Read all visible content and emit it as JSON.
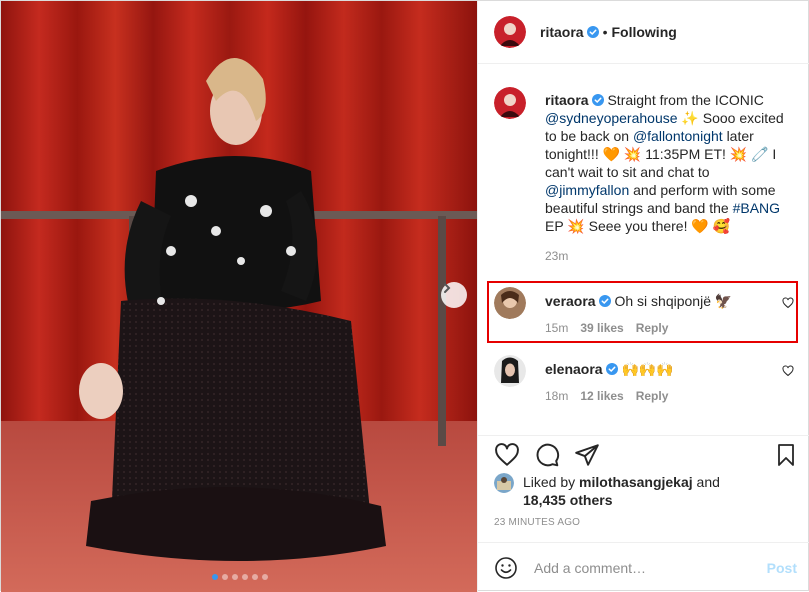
{
  "header": {
    "username": "ritaora",
    "separator": "•",
    "follow_state": "Following"
  },
  "caption": {
    "username": "ritaora",
    "t1": "Straight from the ICONIC",
    "mention1": "@sydneyoperahouse",
    "t2": "✨ Sooo excited to be back on",
    "mention2": "@fallontonight",
    "t3": "later tonight!!! 🧡 💥 11:35PM ET! 💥 🧷 I can't wait to sit and chat to",
    "mention3": "@jimmyfallon",
    "t4": "and perform with some beautiful strings and band the",
    "hashtag": "#BANG",
    "t5": "EP 💥 Seee you there! 🧡 🥰",
    "time": "23m"
  },
  "comments": [
    {
      "username": "veraora",
      "text": "Oh si shqiponjë 🦅",
      "time": "15m",
      "likes": "39 likes",
      "reply": "Reply"
    },
    {
      "username": "elenaora",
      "text": "🙌🙌🙌",
      "time": "18m",
      "likes": "12 likes",
      "reply": "Reply"
    }
  ],
  "likes": {
    "prefix": "Liked by",
    "user": "milothasangjekaj",
    "and": "and",
    "count": "18,435 others"
  },
  "timestamp": "23 MINUTES AGO",
  "add_comment": {
    "placeholder": "Add a comment…",
    "post_label": "Post"
  },
  "carousel": {
    "slides": 6,
    "active": 1
  },
  "colors": {
    "verified": "#3897f0",
    "link": "#00376b",
    "highlight": "#e60000",
    "curtain": "#b31c14"
  }
}
